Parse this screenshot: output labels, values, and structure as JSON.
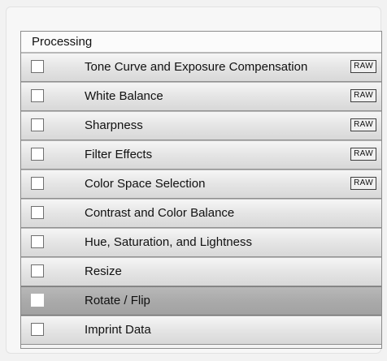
{
  "group": {
    "title": "Processing"
  },
  "rows": [
    {
      "label": "Tone Curve and Exposure Compensation",
      "badge": "RAW",
      "checked": false,
      "selected": false
    },
    {
      "label": "White Balance",
      "badge": "RAW",
      "checked": false,
      "selected": false
    },
    {
      "label": "Sharpness",
      "badge": "RAW",
      "checked": false,
      "selected": false
    },
    {
      "label": "Filter Effects",
      "badge": "RAW",
      "checked": false,
      "selected": false
    },
    {
      "label": "Color Space Selection",
      "badge": "RAW",
      "checked": false,
      "selected": false
    },
    {
      "label": "Contrast and Color Balance",
      "badge": "",
      "checked": false,
      "selected": false
    },
    {
      "label": "Hue, Saturation, and Lightness",
      "badge": "",
      "checked": false,
      "selected": false
    },
    {
      "label": "Resize",
      "badge": "",
      "checked": false,
      "selected": false
    },
    {
      "label": "Rotate / Flip",
      "badge": "",
      "checked": false,
      "selected": true
    },
    {
      "label": "Imprint Data",
      "badge": "",
      "checked": false,
      "selected": false
    }
  ]
}
